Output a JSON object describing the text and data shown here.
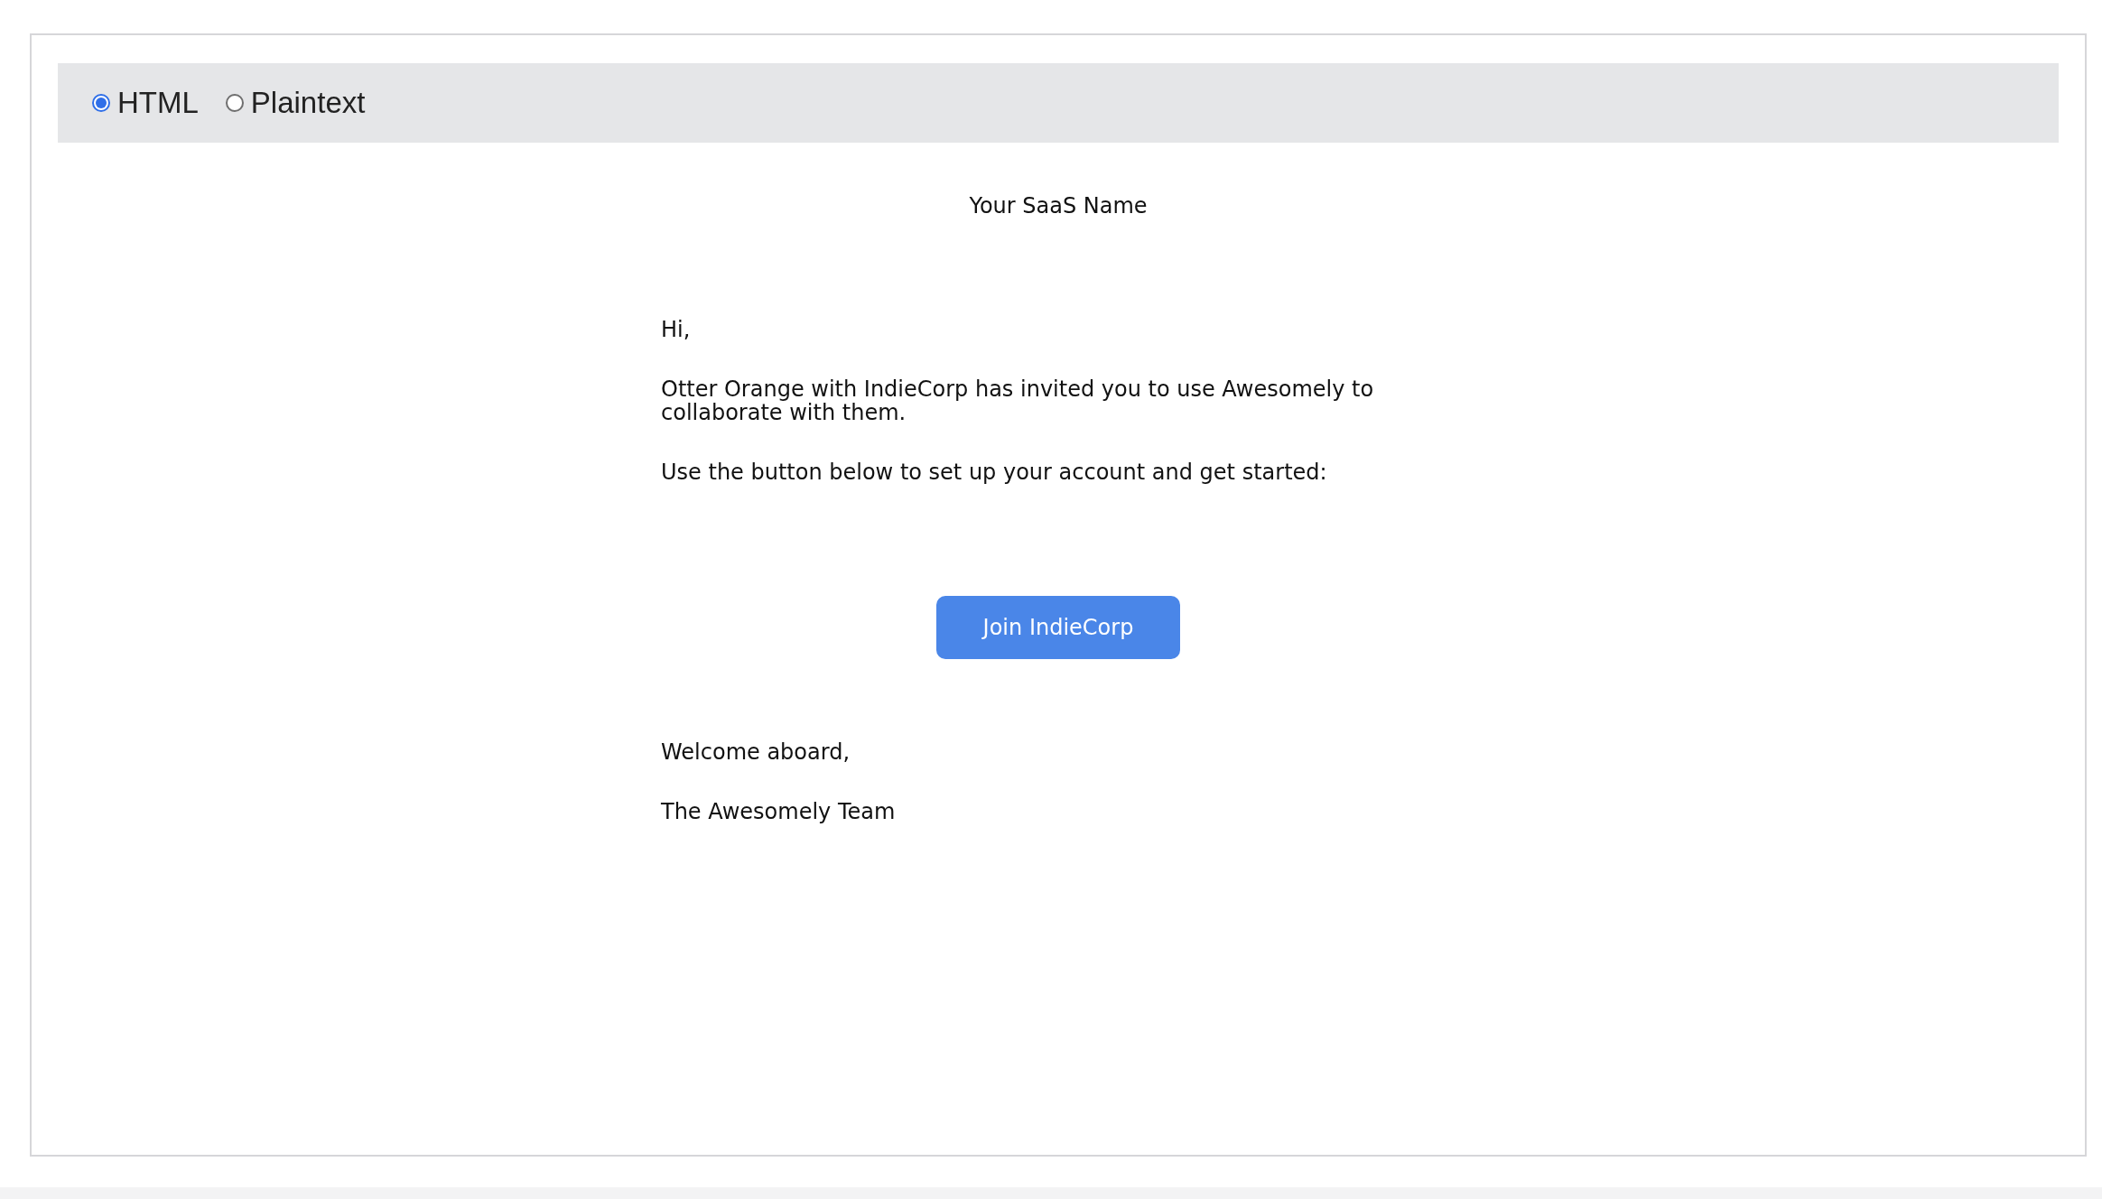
{
  "format_options": [
    {
      "label": "HTML",
      "selected": true
    },
    {
      "label": "Plaintext",
      "selected": false
    }
  ],
  "email": {
    "brand": "Your SaaS Name",
    "greeting": "Hi,",
    "paragraphs": [
      "Otter Orange with IndieCorp has invited you to use Awesomely to collaborate with them.",
      "Use the button below to set up your account and get started:"
    ],
    "button": "Join IndieCorp",
    "closing": [
      "Welcome aboard,",
      "The Awesomely Team"
    ]
  }
}
